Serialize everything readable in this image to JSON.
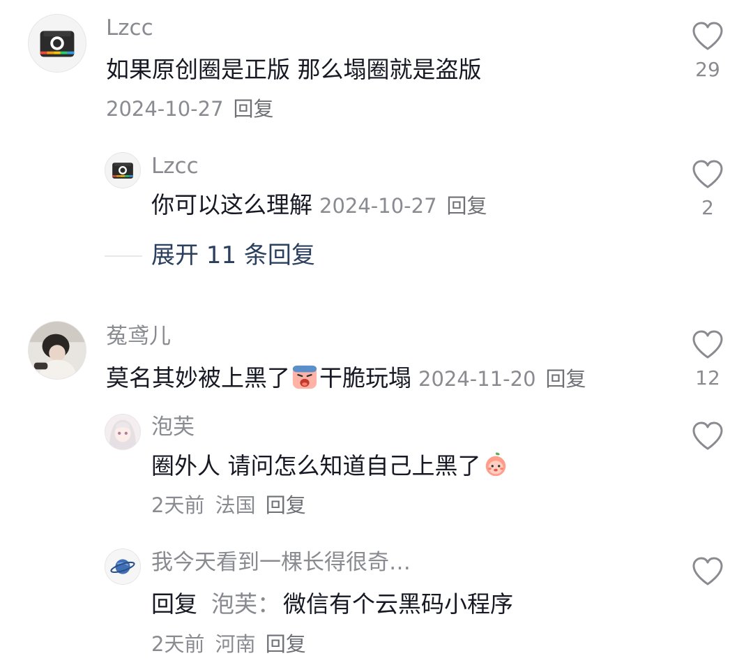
{
  "comments": [
    {
      "author": "Lzcc",
      "text": "如果原创圈是正版 那么塌圈就是盗版",
      "date": "2024-10-27",
      "reply_label": "回复",
      "likes": "29",
      "avatar_icon": "camera-icon",
      "replies": [
        {
          "author": "Lzcc",
          "text": "你可以这么理解",
          "date": "2024-10-27",
          "reply_label": "回复",
          "likes": "2",
          "avatar_icon": "camera-icon"
        }
      ],
      "expand_label": "展开 11 条回复"
    },
    {
      "author": "菟鸢儿",
      "text_before": "莫名其妙被上黑了",
      "emoji": "crying-face-emoji",
      "text_after": "干脆玩塌",
      "date": "2024-11-20",
      "reply_label": "回复",
      "likes": "12",
      "avatar_icon": "photo-avatar",
      "replies": [
        {
          "author": "泡芙",
          "text": "圈外人 请问怎么知道自己上黑了",
          "emoji": "peach-character-emoji",
          "time": "2天前",
          "location": "法国",
          "reply_label": "回复",
          "avatar_icon": "anime-avatar"
        },
        {
          "author": "我今天看到一棵长得很奇…",
          "reply_prefix": "回复",
          "reply_to": "泡芙：",
          "text": "微信有个云黑码小程序",
          "time": "2天前",
          "location": "河南",
          "reply_label": "回复",
          "avatar_icon": "planet-icon"
        }
      ]
    }
  ],
  "colors": {
    "text": "#161823",
    "meta": "#8a8b91",
    "expand": "#2a3f5e",
    "background": "#ffffff"
  }
}
